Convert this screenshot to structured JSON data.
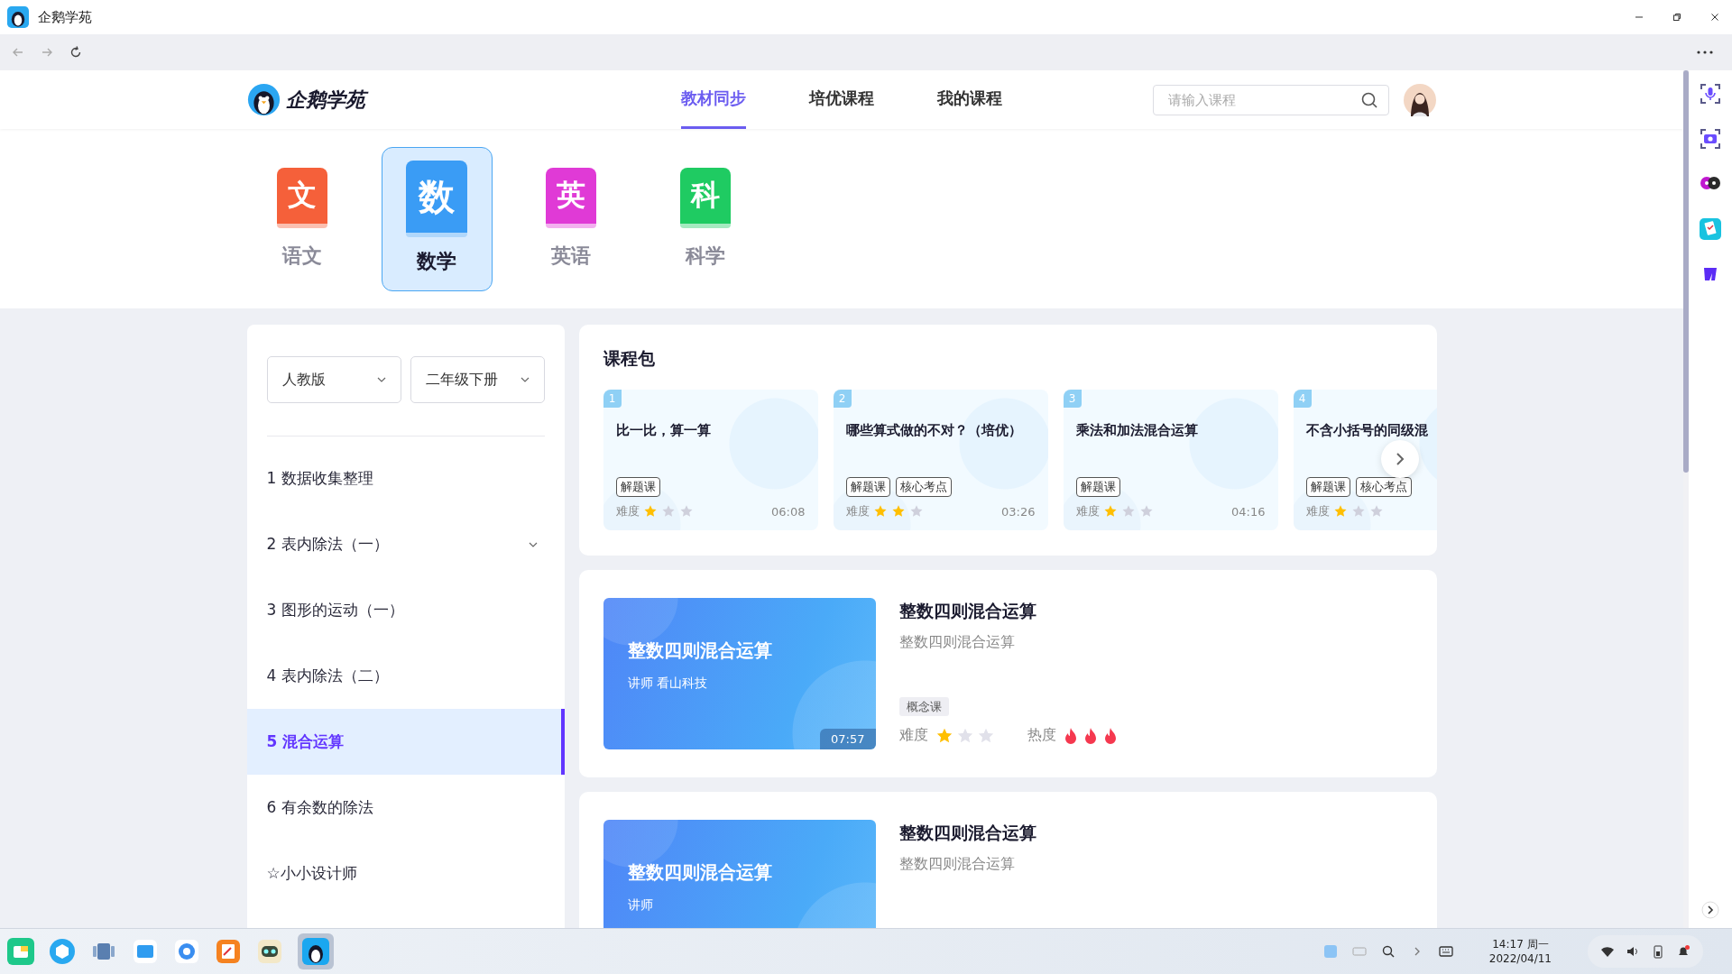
{
  "window": {
    "title": "企鹅学苑"
  },
  "header": {
    "brand": "企鹅学苑",
    "tabs": [
      {
        "label": "教材同步",
        "selected": true
      },
      {
        "label": "培优课程",
        "selected": false
      },
      {
        "label": "我的课程",
        "selected": false
      }
    ],
    "search": {
      "placeholder": "请输入课程"
    }
  },
  "subjects": [
    {
      "glyph": "文",
      "label": "语文",
      "color": "#f5603a",
      "selected": false
    },
    {
      "glyph": "数",
      "label": "数学",
      "color": "#3a9cf5",
      "selected": true
    },
    {
      "glyph": "英",
      "label": "英语",
      "color": "#e03ad6",
      "selected": false
    },
    {
      "glyph": "科",
      "label": "科学",
      "color": "#1fcb62",
      "selected": false
    }
  ],
  "filters": [
    {
      "value": "人教版"
    },
    {
      "value": "二年级下册"
    }
  ],
  "chapters": [
    {
      "label": "1 数据收集整理",
      "selected": false,
      "has_children": false
    },
    {
      "label": "2 表内除法（一）",
      "selected": false,
      "has_children": true
    },
    {
      "label": "3 图形的运动（一）",
      "selected": false,
      "has_children": false
    },
    {
      "label": "4 表内除法（二）",
      "selected": false,
      "has_children": false
    },
    {
      "label": "5 混合运算",
      "selected": true,
      "has_children": false
    },
    {
      "label": "6 有余数的除法",
      "selected": false,
      "has_children": false
    },
    {
      "label": "☆小小设计师",
      "selected": false,
      "has_children": false
    }
  ],
  "package": {
    "title": "课程包",
    "cards": [
      {
        "index": "1",
        "title": "比一比，算一算",
        "tags": [
          "解题课"
        ],
        "difficulty_label": "难度",
        "stars": 1,
        "duration": "06:08"
      },
      {
        "index": "2",
        "title": "哪些算式做的不对？（培优）",
        "tags": [
          "解题课",
          "核心考点"
        ],
        "difficulty_label": "难度",
        "stars": 2,
        "duration": "03:26"
      },
      {
        "index": "3",
        "title": "乘法和加法混合运算",
        "tags": [
          "解题课"
        ],
        "difficulty_label": "难度",
        "stars": 1,
        "duration": "04:16"
      },
      {
        "index": "4",
        "title": "不含小括号的同级混",
        "tags": [
          "解题课",
          "核心考点"
        ],
        "difficulty_label": "难度",
        "stars": 1
      }
    ]
  },
  "courses": [
    {
      "cover_title": "整数四则混合运算",
      "lecturer": "讲师 看山科技",
      "duration": "07:57",
      "title": "整数四则混合运算",
      "subtitle": "整数四则混合运算",
      "tags": [
        "概念课"
      ],
      "difficulty": {
        "label": "难度",
        "stars": 1
      },
      "heat": {
        "label": "热度",
        "stars": 3
      }
    },
    {
      "cover_title": "整数四则混合运算",
      "lecturer": "讲师",
      "title": "整数四则混合运算",
      "subtitle": "整数四则混合运算"
    }
  ],
  "taskbar": {
    "time": "14:17 周一",
    "date": "2022/04/11"
  }
}
